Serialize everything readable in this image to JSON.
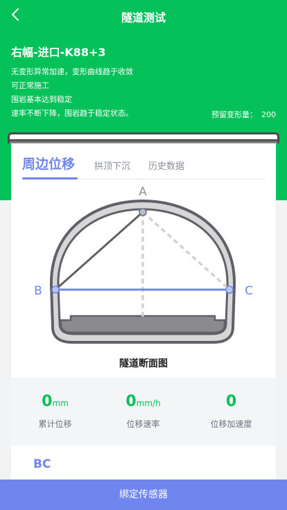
{
  "header": {
    "title": "隧道测试",
    "site_name": "右幅-进口-K88+3",
    "status_lines": [
      "无变形异常加速，变形曲线趋于收敛",
      "可正常施工",
      "围岩基本达到稳定",
      "速率不断下降，围岩趋于稳定状态。"
    ],
    "reserve_label": "预留变形量：",
    "reserve_value": "200"
  },
  "tabs": [
    {
      "label": "周边位移",
      "active": true
    },
    {
      "label": "拱顶下沉",
      "active": false
    },
    {
      "label": "历史数据",
      "active": false
    }
  ],
  "diagram": {
    "points": {
      "a": "A",
      "b": "B",
      "c": "C"
    },
    "caption": "隧道断面图",
    "highlight_color": "#6f86ee"
  },
  "stats": [
    {
      "value": "0",
      "unit": "mm",
      "label": "累计位移"
    },
    {
      "value": "0",
      "unit": "mm/h",
      "label": "位移速率"
    },
    {
      "value": "0",
      "unit": "",
      "label": "位移加速度"
    }
  ],
  "section": {
    "title": "BC"
  },
  "actions": {
    "bind_label": "绑定传感器"
  },
  "colors": {
    "brand_green": "#04c159",
    "accent_blue": "#6f86ee"
  }
}
